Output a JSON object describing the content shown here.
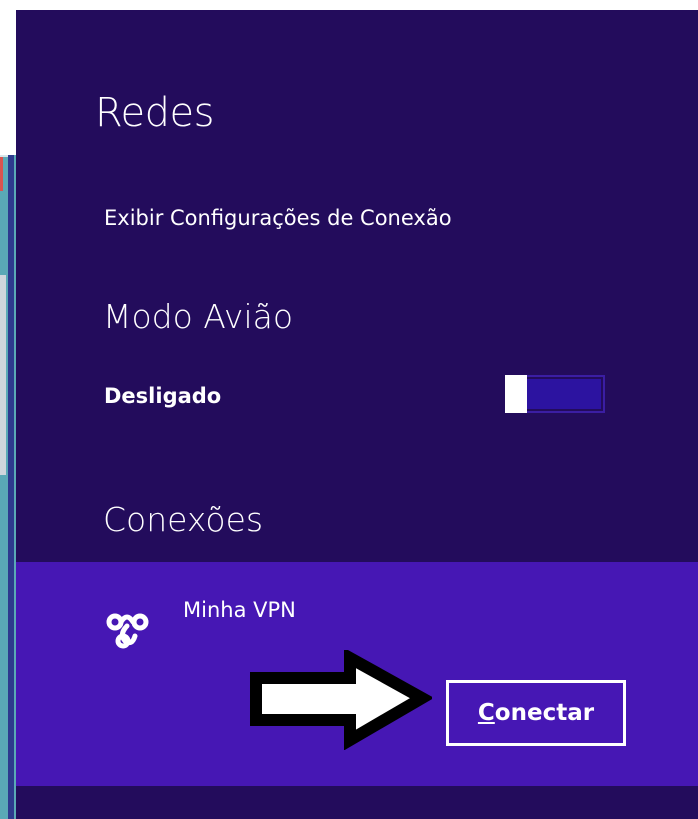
{
  "panel": {
    "title": "Redes",
    "view_settings_link": "Exibir Configurações de Conexão",
    "airplane_mode": {
      "label": "Modo Avião",
      "state_text": "Desligado",
      "enabled": false
    },
    "connections": {
      "label": "Conexões",
      "items": [
        {
          "icon": "vpn-icon",
          "name": "Minha VPN",
          "connect_access_key": "C",
          "connect_rest": "onectar"
        }
      ]
    }
  },
  "annotation": {
    "icon": "arrow-right-icon"
  },
  "colors": {
    "panel_bg": "#230c5c",
    "selected_row_bg": "#4617b4",
    "toggle_track": "#2c13a0",
    "text": "#ffffff",
    "desktop_strip": "#5aa9b6"
  }
}
